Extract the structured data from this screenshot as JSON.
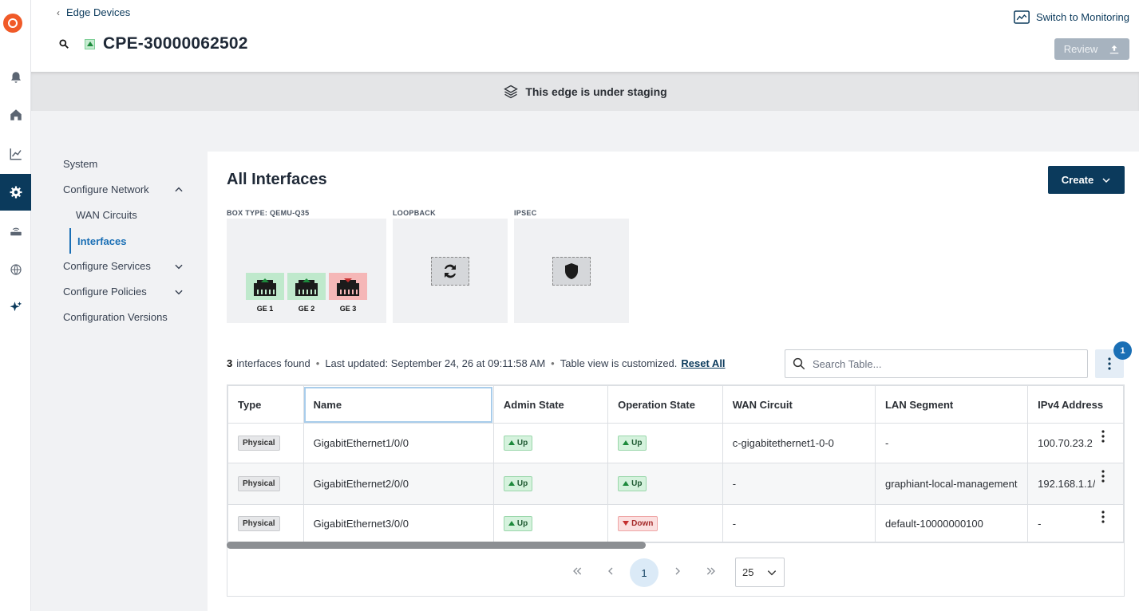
{
  "rail": {
    "icons": [
      "logo-icon",
      "bell-icon",
      "home-icon",
      "chart-icon",
      "gear-icon",
      "router-icon",
      "globe-icon",
      "sparkle-icon"
    ],
    "active": "gear-icon",
    "accent": "#0b3a5c"
  },
  "header": {
    "back_label": "Edge Devices",
    "device_name": "CPE-30000062502",
    "switch_label": "Switch to Monitoring",
    "review_label": "Review"
  },
  "banner": {
    "text": "This edge is under staging"
  },
  "nav": {
    "system": "System",
    "configure_network": "Configure Network",
    "wan_circuits": "WAN Circuits",
    "interfaces": "Interfaces",
    "configure_services": "Configure Services",
    "configure_policies": "Configure Policies",
    "configuration_versions": "Configuration Versions"
  },
  "main": {
    "title": "All Interfaces",
    "create_label": "Create",
    "box_type_label": "BOX TYPE: QEMU-Q35",
    "loopback_label": "LOOPBACK",
    "ipsec_label": "IPSEC",
    "ports": [
      {
        "label": "GE 1",
        "state": "up"
      },
      {
        "label": "GE 2",
        "state": "up"
      },
      {
        "label": "GE 3",
        "state": "down"
      }
    ]
  },
  "summary": {
    "count": "3",
    "found_text": "interfaces found",
    "updated_text": "Last updated: September 24, 26 at 09:11:58 AM",
    "customized_text": "Table view is customized.",
    "reset_label": "Reset All"
  },
  "search": {
    "placeholder": "Search Table..."
  },
  "badge_count": "1",
  "table": {
    "columns": [
      "Type",
      "Name",
      "Admin State",
      "Operation State",
      "WAN Circuit",
      "LAN Segment",
      "IPv4 Address"
    ],
    "rows": [
      {
        "type": "Physical",
        "name": "GigabitEthernet1/0/0",
        "admin": "Up",
        "oper": "Up",
        "wan": "c-gigabitethernet1-0-0",
        "lan": "-",
        "ipv4": "100.70.23.2"
      },
      {
        "type": "Physical",
        "name": "GigabitEthernet2/0/0",
        "admin": "Up",
        "oper": "Up",
        "wan": "-",
        "lan": "graphiant-local-management",
        "ipv4": "192.168.1.1/"
      },
      {
        "type": "Physical",
        "name": "GigabitEthernet3/0/0",
        "admin": "Up",
        "oper": "Down",
        "wan": "-",
        "lan": "default-10000000100",
        "ipv4": "-"
      }
    ]
  },
  "pager": {
    "current": "1",
    "page_size": "25"
  }
}
